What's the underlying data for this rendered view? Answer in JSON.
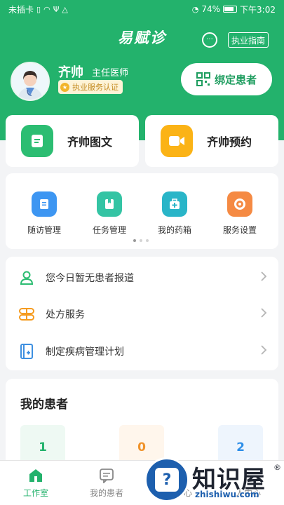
{
  "status_bar": {
    "carrier": "未插卡",
    "battery": "74%",
    "time": "下午3:02"
  },
  "header": {
    "app_title": "易赋诊",
    "guide_label": "执业指南"
  },
  "doctor": {
    "name": "齐帅",
    "title": "主任医师",
    "cert_label": "执业服务认证",
    "bind_label": "绑定患者"
  },
  "quick_cards": [
    {
      "label": "齐帅图文",
      "icon": "document-icon",
      "color": "#2cbd72"
    },
    {
      "label": "齐帅预约",
      "icon": "video-icon",
      "color": "#fbb316"
    }
  ],
  "services": [
    {
      "label": "随访管理",
      "icon": "followup-icon",
      "color": "#3d96f2"
    },
    {
      "label": "任务管理",
      "icon": "task-icon",
      "color": "#34c4a4"
    },
    {
      "label": "我的药箱",
      "icon": "medicine-box-icon",
      "color": "#29b5c8"
    },
    {
      "label": "服务设置",
      "icon": "service-settings-icon",
      "color": "#f58a43"
    }
  ],
  "list_rows": [
    {
      "label": "您今日暂无患者报道",
      "icon": "person-icon",
      "color": "#2cbd72"
    },
    {
      "label": "处方服务",
      "icon": "prescription-icon",
      "color": "#f59b1f"
    },
    {
      "label": "制定疾病管理计划",
      "icon": "plan-icon",
      "color": "#3d8fe0"
    }
  ],
  "patients": {
    "title": "我的患者",
    "counts": [
      {
        "value": "1",
        "color": "#23b26c",
        "bg": "#eef9f3"
      },
      {
        "value": "0",
        "color": "#f0932b",
        "bg": "#fff6ec"
      },
      {
        "value": "2",
        "color": "#2d8ee8",
        "bg": "#eef5fd"
      }
    ]
  },
  "tabs": [
    {
      "label": "工作室",
      "icon": "home-icon",
      "active": true
    },
    {
      "label": "我的患者",
      "icon": "patients-icon",
      "active": false
    },
    {
      "label": "心",
      "icon": "message-icon",
      "active": false
    },
    {
      "label": "人中心",
      "icon": "profile-icon",
      "active": false
    }
  ],
  "watermark": {
    "brand": "知识屋",
    "url": "zhishiwu.com",
    "reg": "®"
  },
  "colors": {
    "primary": "#23b26c",
    "background": "#f3f4f6"
  }
}
